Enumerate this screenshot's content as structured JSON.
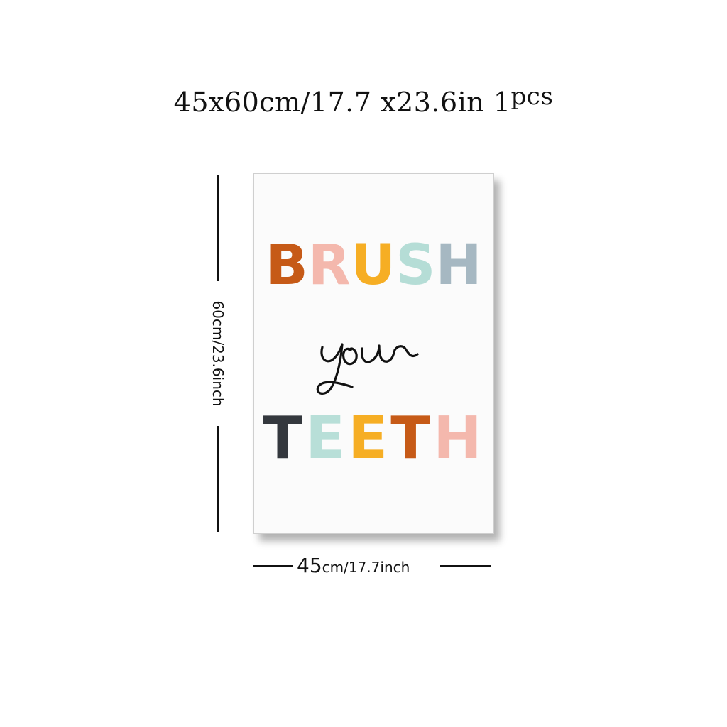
{
  "headline": {
    "main": "45x60cm/17.7 x23.6in 1",
    "sup": "pcs"
  },
  "vertical_dimension": "60cm/23.6inch",
  "horizontal_dimension": {
    "big": "45",
    "rest": "cm/17.7inch"
  },
  "poster": {
    "line1": "BRUSH",
    "line2": "your",
    "line3": "TEETH",
    "line1_colors": [
      "#c65a17",
      "#f4b8ad",
      "#f6ae24",
      "#b5ddd6",
      "#a6b8c2"
    ],
    "line3_colors": [
      "#34383e",
      "#b8dfd8",
      "#f6ae24",
      "#c65a17",
      "#f4b8ad"
    ]
  }
}
